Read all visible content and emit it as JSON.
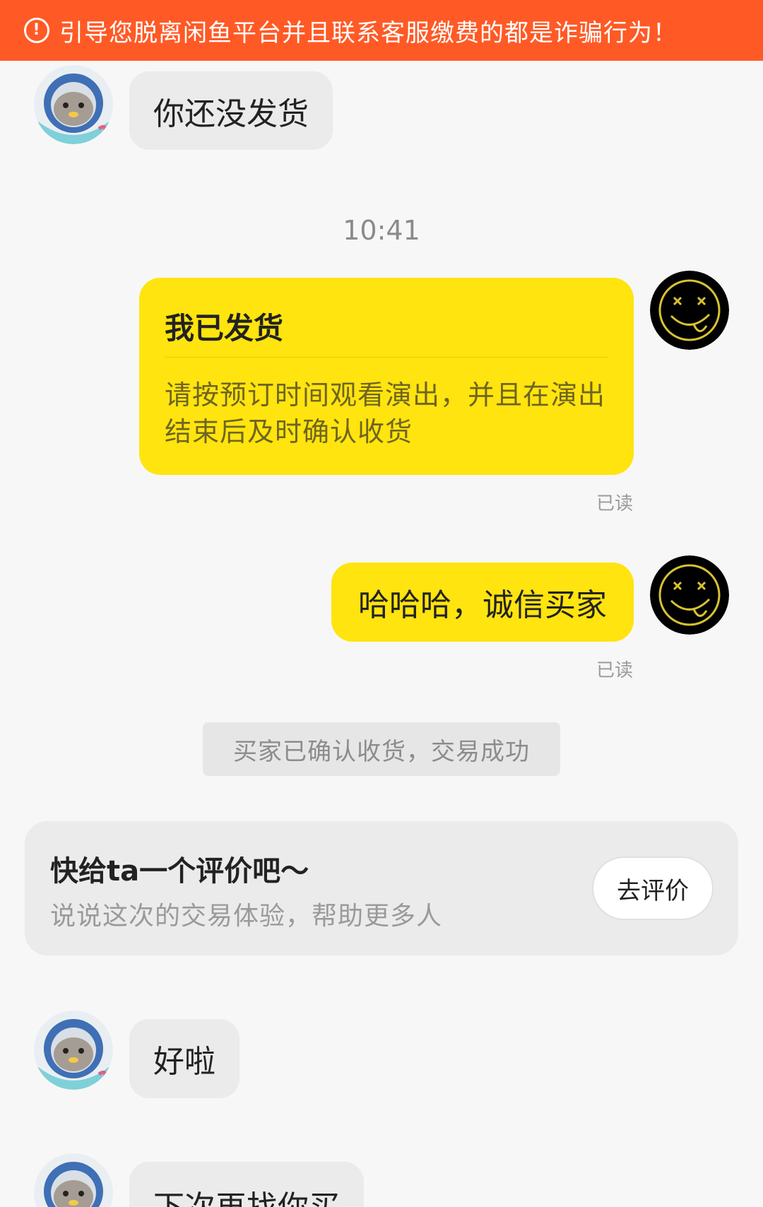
{
  "banner": {
    "icon": "alert-circle-icon",
    "text": "引导您脱离闲鱼平台并且联系客服缴费的都是诈骗行为！"
  },
  "messages": {
    "m1": {
      "text": "你还没发货"
    },
    "timestamp": "10:41",
    "m2": {
      "title": "我已发货",
      "body_line1": "请按预订时间观看演出，并且在演出",
      "body_line2": "结束后及时确认收货",
      "status": "已读"
    },
    "m3": {
      "text": "哈哈哈，诚信买家",
      "status": "已读"
    },
    "system": "买家已确认收货，交易成功",
    "review": {
      "title": "快给ta一个评价吧～",
      "subtitle": "说说这次的交易体验，帮助更多人",
      "button": "去评价"
    },
    "m4": {
      "text": "好啦"
    },
    "m5": {
      "text": "下次再找你买"
    }
  },
  "colors": {
    "banner": "#ff5a26",
    "outgoing_bubble": "#ffe40f",
    "incoming_bubble": "#ebebeb",
    "background": "#f7f7f7"
  }
}
